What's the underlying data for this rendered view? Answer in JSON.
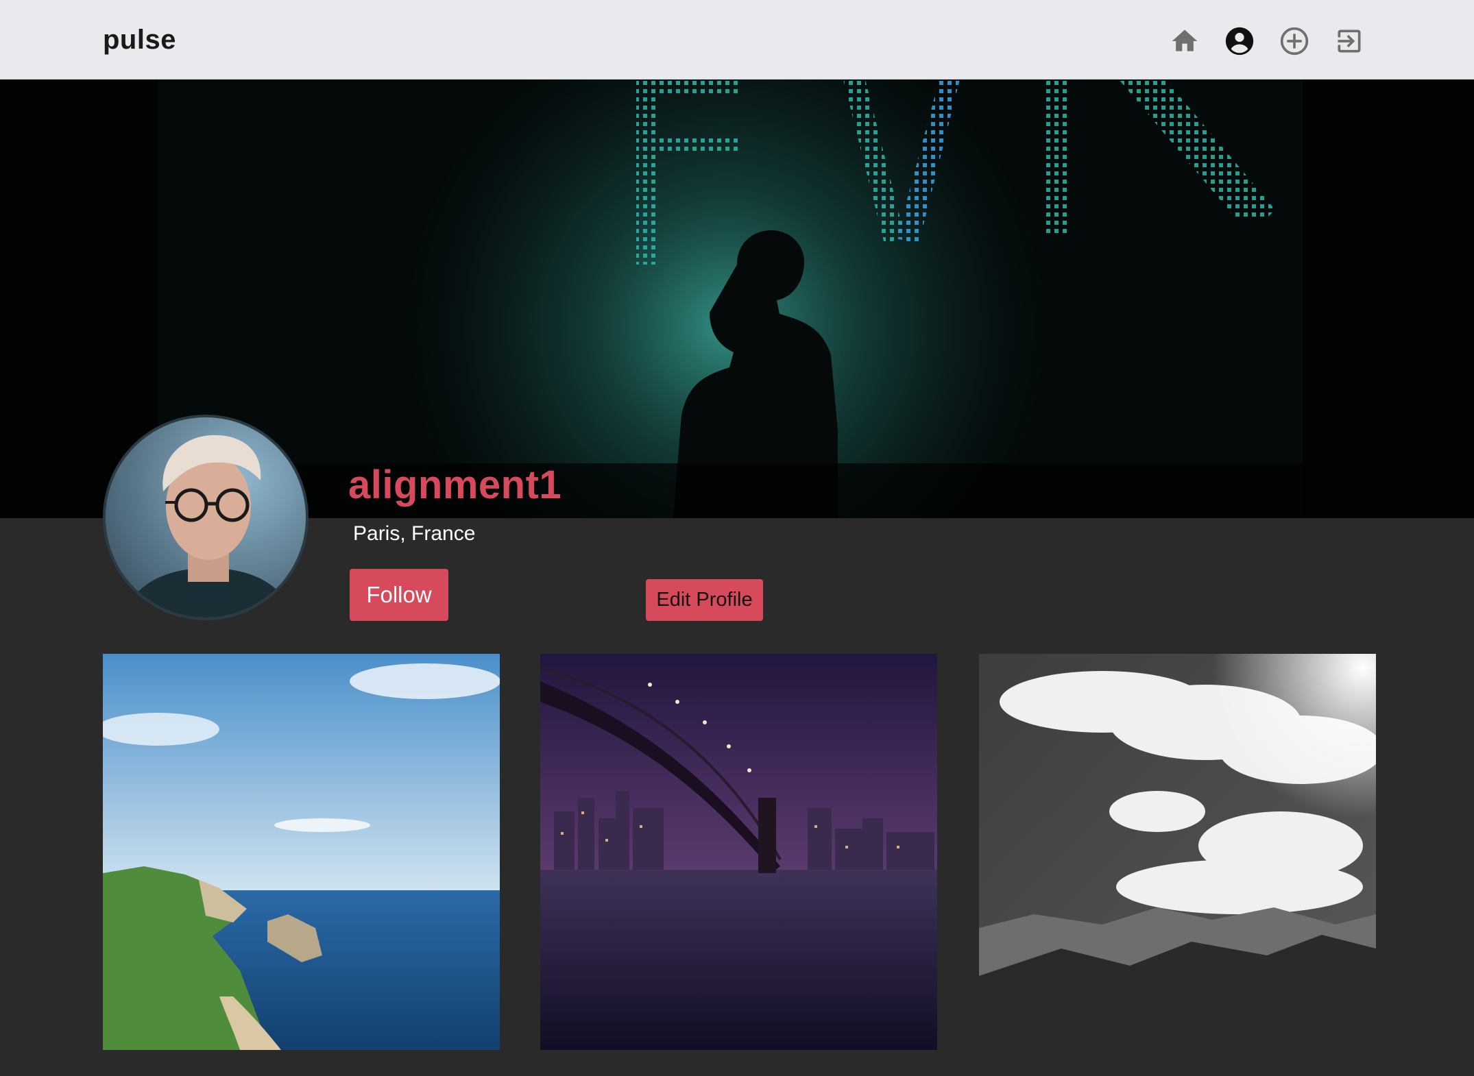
{
  "navbar": {
    "brand": "pulse",
    "icons": [
      "home-icon",
      "account-circle-icon",
      "add-circle-icon",
      "sign-in-icon"
    ]
  },
  "profile": {
    "username": "alignment1",
    "location": "Paris, France",
    "follow_label": "Follow",
    "edit_label": "Edit Profile"
  },
  "colors": {
    "accent": "#d64a5b",
    "navbar_bg": "#e9eaee",
    "page_bg": "#2a2a2a",
    "cover_glow": "#2e9a88"
  },
  "photos": [
    {
      "subject": "coastal cliffs and sea under blue sky"
    },
    {
      "subject": "suspension bridge over river with city skyline at night"
    },
    {
      "subject": "black and white clouds over mountains"
    }
  ]
}
